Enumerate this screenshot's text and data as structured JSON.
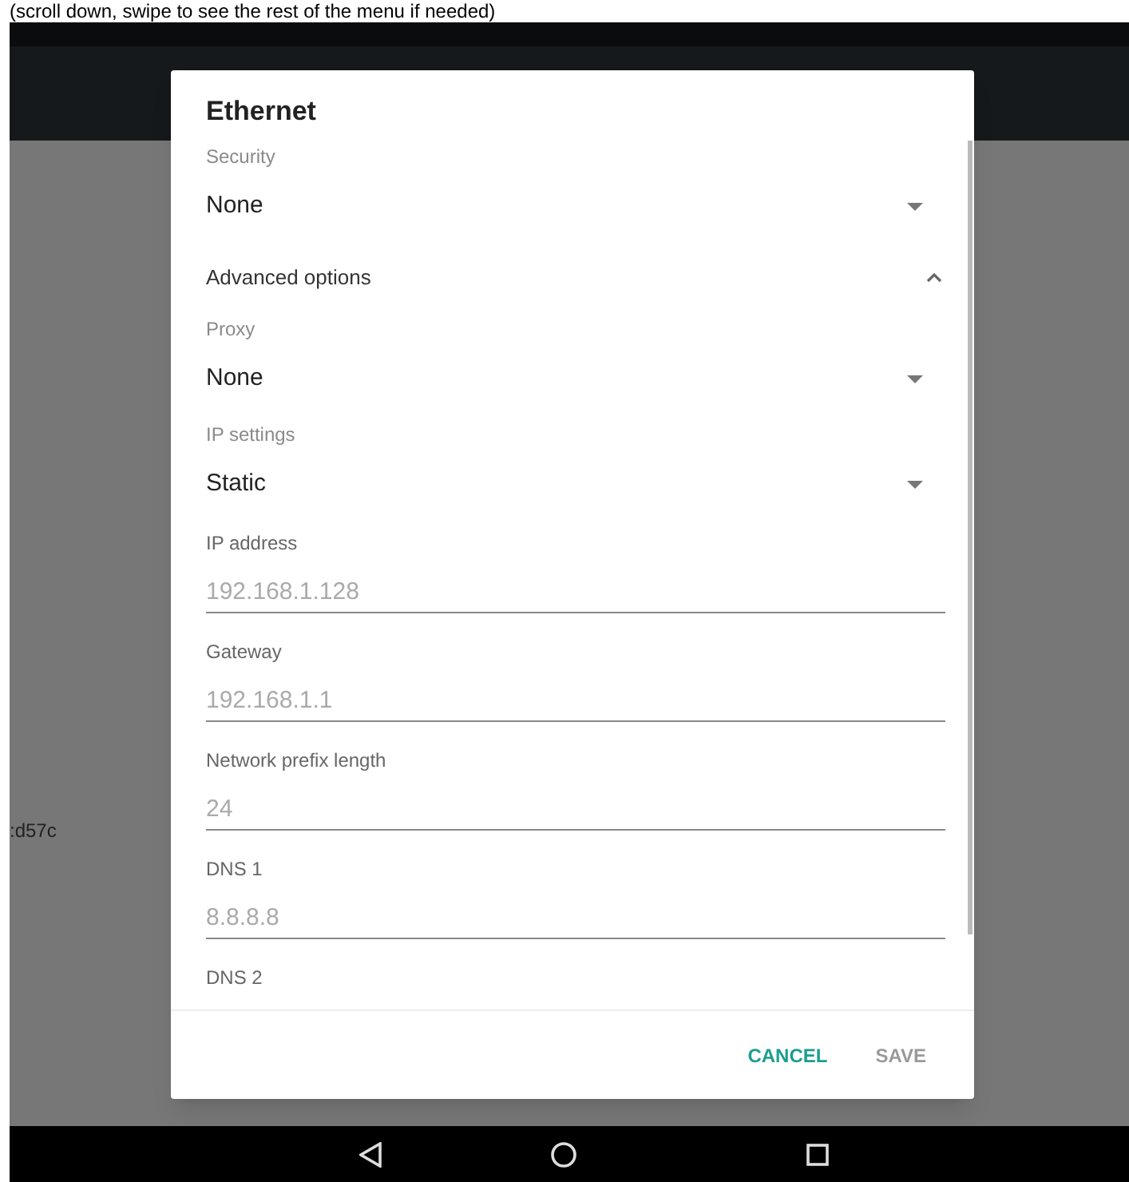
{
  "caption": "(scroll down, swipe to see the rest of the menu if needed)",
  "background": {
    "text": ":d57c"
  },
  "dialog": {
    "title": "Ethernet",
    "fields": [
      {
        "kind": "dropdown",
        "label": "Security",
        "value": "None"
      },
      {
        "kind": "section",
        "label": "Advanced options",
        "expanded": true
      },
      {
        "kind": "dropdown",
        "label": "Proxy",
        "value": "None"
      },
      {
        "kind": "dropdown",
        "label": "IP settings",
        "value": "Static"
      },
      {
        "kind": "text",
        "label": "IP address",
        "placeholder": "192.168.1.128"
      },
      {
        "kind": "text",
        "label": "Gateway",
        "placeholder": "192.168.1.1"
      },
      {
        "kind": "text",
        "label": "Network prefix length",
        "placeholder": "24"
      },
      {
        "kind": "text",
        "label": "DNS 1",
        "placeholder": "8.8.8.8"
      },
      {
        "kind": "text",
        "label": "DNS 2"
      }
    ],
    "buttons": [
      {
        "label": "CANCEL",
        "disabled": false
      },
      {
        "label": "SAVE",
        "disabled": true
      }
    ]
  }
}
